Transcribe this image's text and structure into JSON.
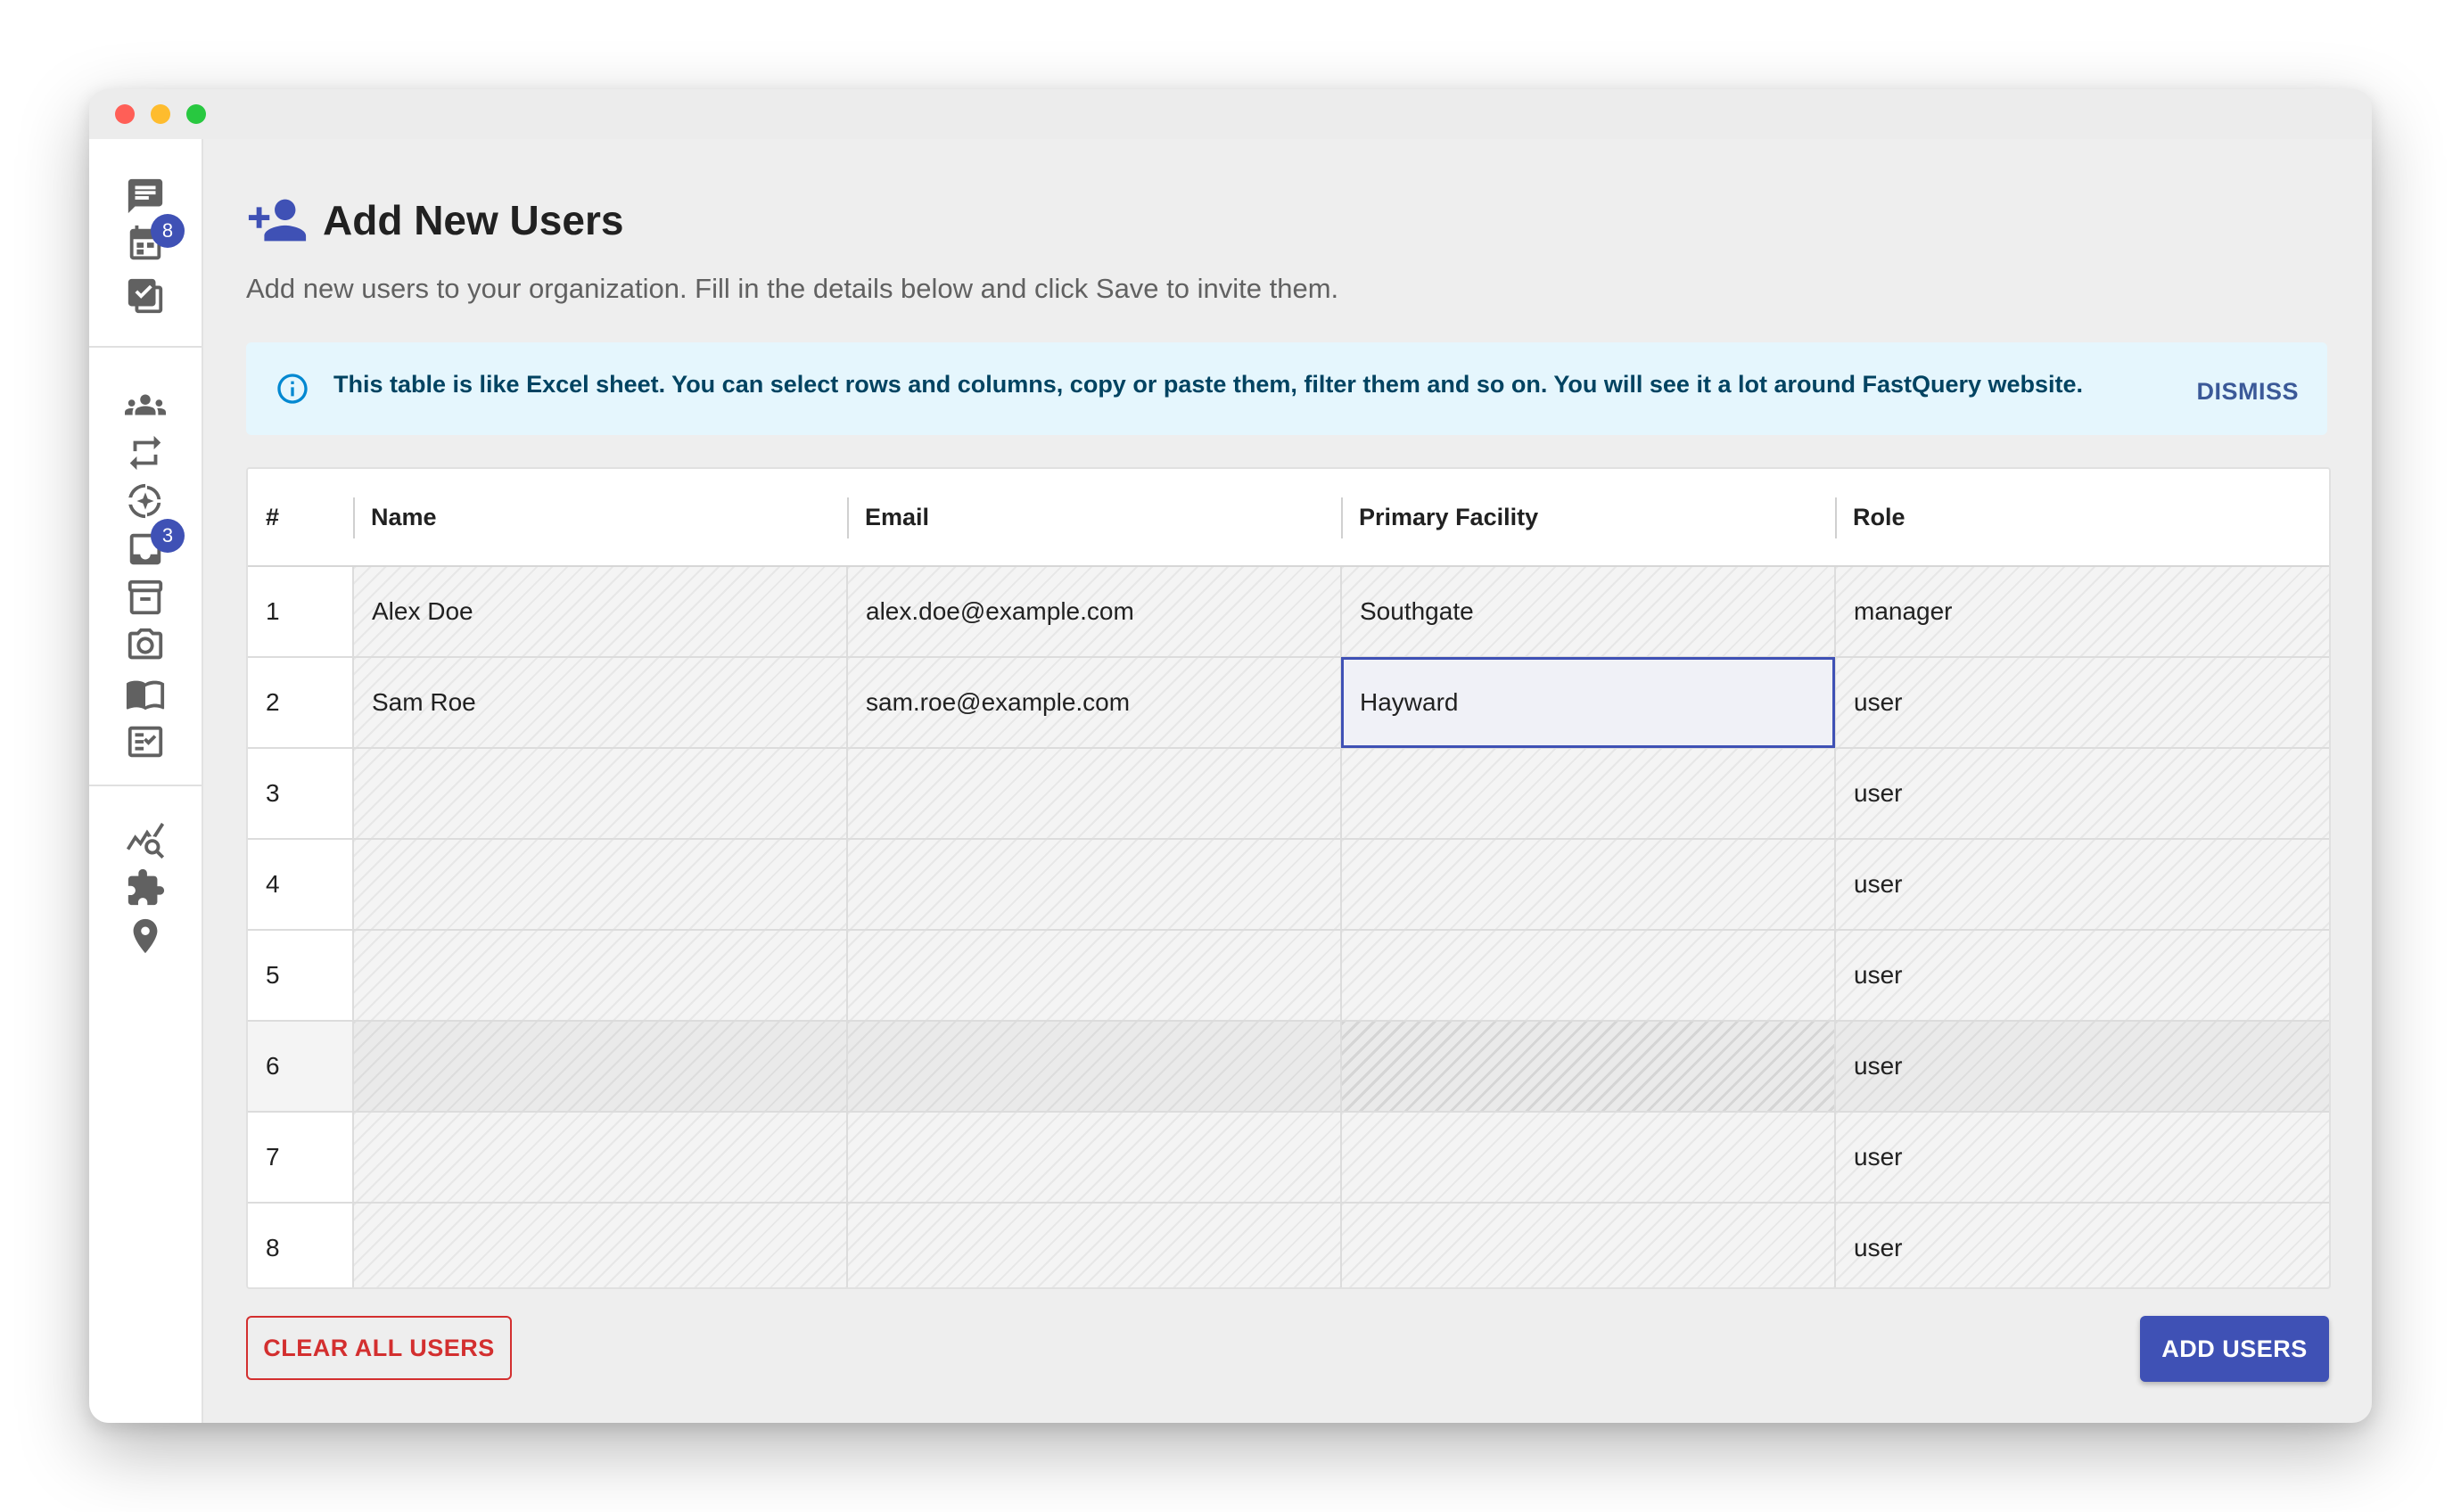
{
  "sidebar": {
    "badges": {
      "calendar": "8",
      "inbox": "3"
    },
    "icons": [
      "chat-icon",
      "calendar-icon",
      "checklist-icon",
      "users-icon",
      "swap-icon",
      "ai-sparkle-icon",
      "inbox-icon",
      "archive-icon",
      "camera-icon",
      "book-icon",
      "task-list-icon",
      "analytics-search-icon",
      "extension-icon",
      "location-pin-icon"
    ]
  },
  "header": {
    "title": "Add New Users",
    "subtitle": "Add new users to your organization. Fill in the details below and click Save to invite them."
  },
  "info_banner": {
    "text": "This table is like Excel sheet. You can select rows and columns, copy or paste them, filter them and so on. You will see it a lot around FastQuery website.",
    "dismiss_label": "DISMISS"
  },
  "table": {
    "columns": [
      "#",
      "Name",
      "Email",
      "Primary Facility",
      "Role"
    ],
    "rows": [
      {
        "num": "1",
        "name": "Alex Doe",
        "email": "alex.doe@example.com",
        "facility": "Southgate",
        "role": "manager"
      },
      {
        "num": "2",
        "name": "Sam Roe",
        "email": "sam.roe@example.com",
        "facility": "Hayward",
        "role": "user"
      },
      {
        "num": "3",
        "name": "",
        "email": "",
        "facility": "",
        "role": "user"
      },
      {
        "num": "4",
        "name": "",
        "email": "",
        "facility": "",
        "role": "user"
      },
      {
        "num": "5",
        "name": "",
        "email": "",
        "facility": "",
        "role": "user"
      },
      {
        "num": "6",
        "name": "",
        "email": "",
        "facility": "",
        "role": "user"
      },
      {
        "num": "7",
        "name": "",
        "email": "",
        "facility": "",
        "role": "user"
      },
      {
        "num": "8",
        "name": "",
        "email": "",
        "facility": "",
        "role": "user"
      }
    ]
  },
  "actions": {
    "clear_label": "CLEAR ALL USERS",
    "add_label": "ADD USERS"
  },
  "colors": {
    "accent": "#3f51b5",
    "danger": "#d32f2f",
    "info_bg": "#e5f6fd",
    "info_text": "#014361"
  }
}
